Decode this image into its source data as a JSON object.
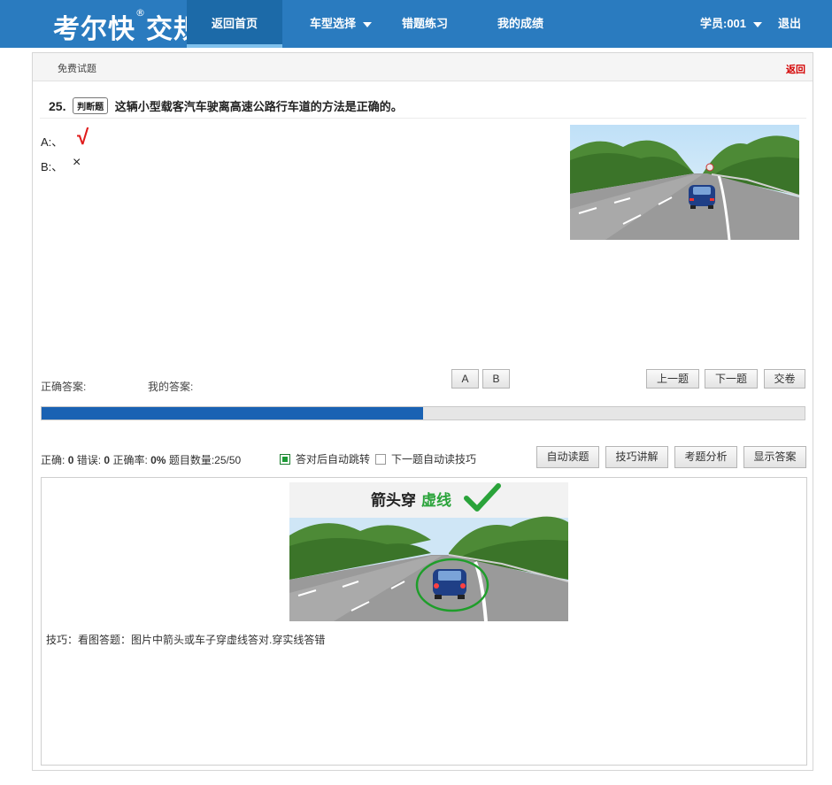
{
  "app": {
    "logo_text": "考尔快",
    "logo_mark": "®",
    "logo_suffix": "交规"
  },
  "nav": {
    "home": "返回首页",
    "model": "车型选择",
    "wrong": "错题练习",
    "score": "我的成绩",
    "user": "学员:001",
    "logout": "退出"
  },
  "subhead": {
    "label": "免费试题",
    "back": "返回"
  },
  "question": {
    "number": "25.",
    "type": "判断题",
    "text": "这辆小型载客汽车驶离高速公路行车道的方法是正确的。",
    "options": [
      {
        "label": "A:、",
        "mark": "√"
      },
      {
        "label": "B:、",
        "mark": "×"
      }
    ]
  },
  "answers": {
    "correct_label": "正确答案:",
    "mine_label": "我的答案:"
  },
  "buttons": {
    "a": "A",
    "b": "B",
    "prev": "上一题",
    "next": "下一题",
    "submit": "交卷",
    "auto_read": "自动读题",
    "skill": "技巧讲解",
    "analysis": "考题分析",
    "show_answer": "显示答案"
  },
  "progress": {
    "fraction": 0.5
  },
  "stats": {
    "correct_label": "正确:",
    "correct_value": "0",
    "wrong_label": "错误:",
    "wrong_value": "0",
    "rate_label": "正确率:",
    "rate_value": "0%",
    "count_label": "题目数量:25/50"
  },
  "options_toggle": {
    "auto_jump": "答对后自动跳转",
    "auto_jump_checked": true,
    "auto_read_skill": "下一题自动读技巧",
    "auto_read_skill_checked": false
  },
  "tip": {
    "image_title": "箭头穿",
    "image_title_highlight": "虚线",
    "text": "技巧：看图答题：图片中箭头或车子穿虚线答对.穿实线答错"
  },
  "colors": {
    "nav_bg": "#2a7bbf",
    "progress": "#1a62b3",
    "correct_mark": "#e01b1b",
    "highlight_green": "#2aa33a"
  }
}
